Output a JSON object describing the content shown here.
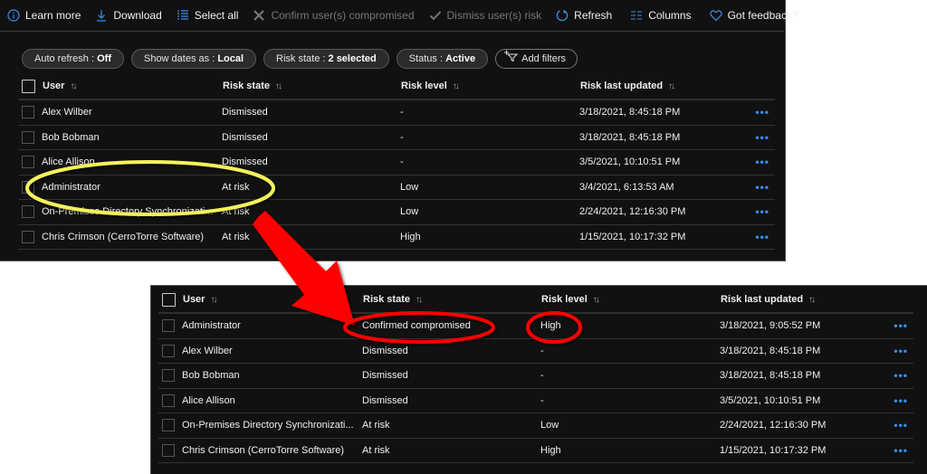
{
  "toolbar": {
    "items": [
      {
        "label": "Learn more",
        "icon": "info-icon",
        "enabled": true
      },
      {
        "label": "Download",
        "icon": "download-icon",
        "enabled": true
      },
      {
        "label": "Select all",
        "icon": "select-all-icon",
        "enabled": true
      },
      {
        "label": "Confirm user(s) compromised",
        "icon": "x-icon",
        "enabled": false
      },
      {
        "label": "Dismiss user(s) risk",
        "icon": "check-icon",
        "enabled": false
      },
      {
        "label": "Refresh",
        "icon": "refresh-icon",
        "enabled": true
      },
      {
        "label": "Columns",
        "icon": "columns-icon",
        "enabled": true
      },
      {
        "label": "Got feedback?",
        "icon": "heart-icon",
        "enabled": true
      }
    ]
  },
  "filters": [
    {
      "key": "Auto refresh : ",
      "value": "Off"
    },
    {
      "key": "Show dates as : ",
      "value": "Local"
    },
    {
      "key": "Risk state : ",
      "value": "2 selected"
    },
    {
      "key": "Status : ",
      "value": "Active"
    }
  ],
  "add_filters_label": "Add filters",
  "columns": {
    "user": "User",
    "risk_state": "Risk state",
    "risk_level": "Risk level",
    "risk_last_updated": "Risk last updated"
  },
  "more_label": "•••",
  "before_table": {
    "rows": [
      {
        "user": "Alex Wilber",
        "risk_state": "Dismissed",
        "risk_level": "-",
        "updated": "3/18/2021, 8:45:18 PM"
      },
      {
        "user": "Bob Bobman",
        "risk_state": "Dismissed",
        "risk_level": "-",
        "updated": "3/18/2021, 8:45:18 PM"
      },
      {
        "user": "Alice Allison",
        "risk_state": "Dismissed",
        "risk_level": "-",
        "updated": "3/5/2021, 10:10:51 PM"
      },
      {
        "user": "Administrator",
        "risk_state": "At risk",
        "risk_level": "Low",
        "updated": "3/4/2021, 6:13:53 AM"
      },
      {
        "user": "On-Premises Directory Synchronizati...",
        "risk_state": "At risk",
        "risk_level": "Low",
        "updated": "2/24/2021, 12:16:30 PM"
      },
      {
        "user": "Chris Crimson (CerroTorre Software)",
        "risk_state": "At risk",
        "risk_level": "High",
        "updated": "1/15/2021, 10:17:32 PM"
      }
    ]
  },
  "after_table": {
    "rows": [
      {
        "user": "Administrator",
        "risk_state": "Confirmed compromised",
        "risk_level": "High",
        "updated": "3/18/2021, 9:05:52 PM"
      },
      {
        "user": "Alex Wilber",
        "risk_state": "Dismissed",
        "risk_level": "-",
        "updated": "3/18/2021, 8:45:18 PM"
      },
      {
        "user": "Bob Bobman",
        "risk_state": "Dismissed",
        "risk_level": "-",
        "updated": "3/18/2021, 8:45:18 PM"
      },
      {
        "user": "Alice Allison",
        "risk_state": "Dismissed",
        "risk_level": "-",
        "updated": "3/5/2021, 10:10:51 PM"
      },
      {
        "user": "On-Premises Directory Synchronizati...",
        "risk_state": "At risk",
        "risk_level": "Low",
        "updated": "2/24/2021, 12:16:30 PM"
      },
      {
        "user": "Chris Crimson (CerroTorre Software)",
        "risk_state": "At risk",
        "risk_level": "High",
        "updated": "1/15/2021, 10:17:32 PM"
      }
    ]
  },
  "annotations": {
    "highlight_color": "#f5f25a",
    "callout_color": "#ff0000",
    "arrow_color": "#ff0000"
  }
}
